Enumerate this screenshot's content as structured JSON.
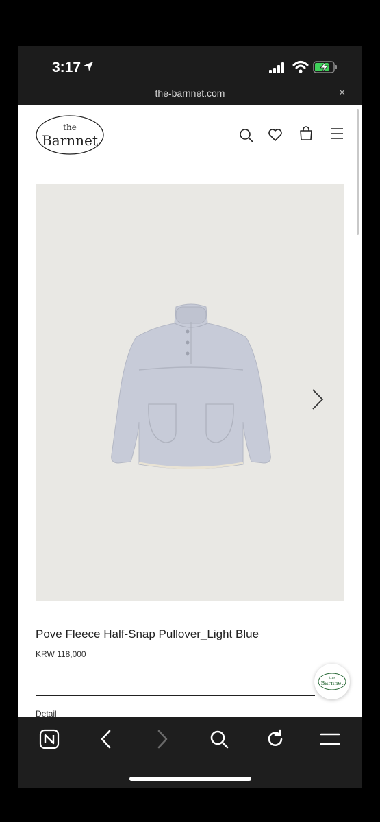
{
  "status_bar": {
    "time": "3:17"
  },
  "browser": {
    "url": "the-barnnet.com",
    "close_glyph": "×"
  },
  "site": {
    "logo": {
      "small": "the",
      "big": "Barnnet"
    },
    "header_icons": [
      "search-icon",
      "heart-icon",
      "bag-icon",
      "menu-icon"
    ]
  },
  "product": {
    "title": "Pove Fleece Half-Snap Pullover_Light Blue",
    "price": "KRW 118,000",
    "color_accent": "#c7cbd8"
  },
  "sections": {
    "detail_label": "Detail"
  },
  "floating_badge": {
    "logo_small": "the",
    "logo_big": "Barnnet"
  },
  "toolbar_icons": [
    "n-app-icon",
    "back-icon",
    "forward-icon",
    "search-icon",
    "reload-icon",
    "menu-icon"
  ]
}
